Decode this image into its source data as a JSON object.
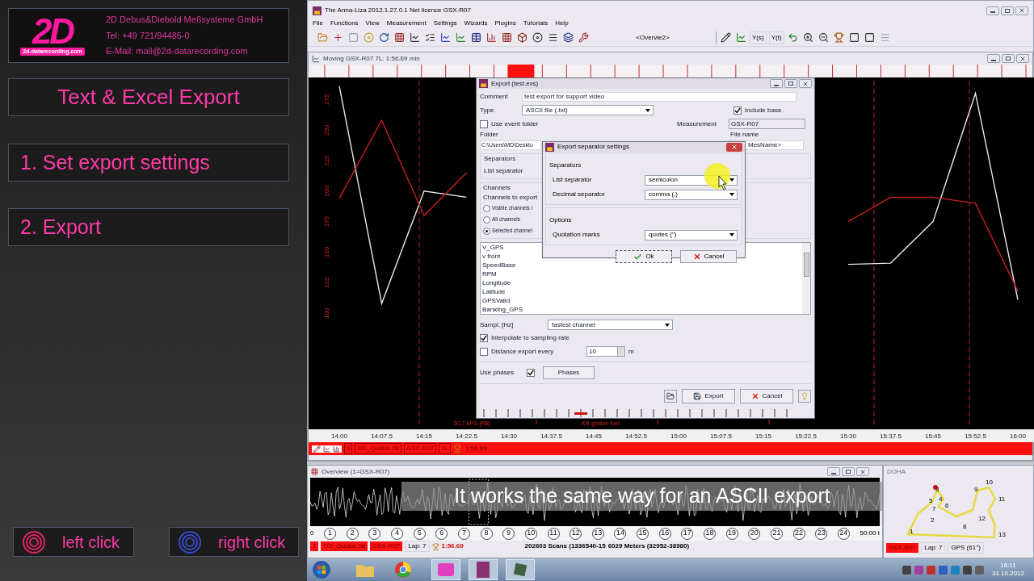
{
  "brand": {
    "logo": "2D",
    "logo_caption": "2d-datarecording.com",
    "company": "2D Debus&Diebold Meßsysteme GmbH",
    "phone": "Tel: +49 721/94485-0",
    "email": "E-Mail: mail@2d-datarecording.com"
  },
  "steps": [
    {
      "kind": "title",
      "label": "Text & Excel Export"
    },
    {
      "kind": "step",
      "label": "1. Set export settings"
    },
    {
      "kind": "step",
      "label": "2. Export"
    }
  ],
  "legend": [
    {
      "label": "left click",
      "color": "#e0245e"
    },
    {
      "label": "right click",
      "color": "#3848c8"
    }
  ],
  "app": {
    "title": "The Anna-Liza 2012.1.27.0.1   Net licence   GSX-R07",
    "menu": [
      "File",
      "Functions",
      "View",
      "Measurement",
      "Settings",
      "Wizards",
      "Plugins",
      "Tutorials",
      "Help"
    ],
    "view_name": "<Overvie2>",
    "axis_buttons": [
      "Y(s)",
      "Y(t)"
    ]
  },
  "moving": {
    "title": "Moving   GSX-R07 7L: 1:56.69 min",
    "markers": [
      "50.7 APS (RB)",
      "Kill ignition fuel"
    ],
    "chart_data": {
      "type": "line",
      "categories": [
        "14:00",
        "14:07.5",
        "14:15",
        "14:22.5",
        "14:30",
        "14:37.5",
        "14:45",
        "14:52.5",
        "15:00",
        "15:07.5",
        "15:15",
        "15:22.5",
        "15:30",
        "15:37.5",
        "15:45",
        "15:52.5",
        "16:00"
      ],
      "series": [
        {
          "color": "#e8e8e8",
          "values": [
            286,
            108,
            200,
            195,
            null,
            null,
            null,
            null,
            null,
            null,
            null,
            null,
            140,
            141,
            175,
            280,
            111
          ]
        },
        {
          "color": "#c82020",
          "values": [
            194,
            258,
            180,
            215,
            null,
            null,
            null,
            null,
            null,
            null,
            null,
            null,
            175,
            195,
            195,
            190,
            118
          ]
        }
      ],
      "ylim": [
        5,
        293
      ],
      "yticks": [
        100,
        125,
        150,
        175,
        200,
        225,
        250,
        275
      ]
    },
    "status": [
      "1",
      "DD_Quatar 08",
      "GSX-R07",
      "7L"
    ],
    "lap_time": "1:56.69"
  },
  "export_dialog": {
    "title": "Export (test.exs)",
    "comment_label": "Comment",
    "comment": "test export for support video",
    "type_label": "Type",
    "type": "ASCII file (.txt)",
    "include_base": {
      "label": "Include base",
      "checked": true
    },
    "use_event_folder": {
      "label": "Use event folder",
      "checked": false
    },
    "measurement_label": "Measurement",
    "measurement": "GSX-R07",
    "folder_label": "Folder",
    "folder": "C:\\Users\\MD\\Deskto",
    "file_name_label": "File name",
    "file_name": "MesName>",
    "separators_label": "Separators",
    "list_separator_label": "List separator",
    "channels_label": "Channels",
    "channels_to_export_label": "Channels to export",
    "channel_modes": [
      {
        "label": "Visible channels i",
        "selected": false
      },
      {
        "label": "All channels",
        "selected": false
      },
      {
        "label": "Selected channel",
        "selected": true
      }
    ],
    "channels": [
      "V_GPS",
      "v front",
      "SpeedBase",
      "RPM",
      "Longitude",
      "Latitude",
      "GPSValid",
      "Banking_GPS"
    ],
    "sampling_label": "Sampl. [Hz]",
    "sampling": "fastest channel",
    "interpolate": {
      "label": "Interpolate to sampling rate",
      "checked": true
    },
    "distance_export": {
      "label": "Distance export every",
      "checked": false
    },
    "distance": "10",
    "distance_unit": "m",
    "use_phases": {
      "label": "Use phases",
      "checked": true
    },
    "phases_button": "Phases",
    "export_button": "Export",
    "cancel_button": "Cancel"
  },
  "separator_dialog": {
    "title": "Export separator settings",
    "separators_label": "Separators",
    "rows": [
      {
        "label": "List separator",
        "value": "semicolon"
      },
      {
        "label": "Decimal separator",
        "value": "comma (,)"
      }
    ],
    "options_label": "Options",
    "options": [
      {
        "label": "Quotation marks",
        "value": "quotes (\")"
      }
    ],
    "ok_button": "Ok",
    "cancel_button": "Cancel"
  },
  "overview": {
    "title": "Overview (1=GSX-R07)",
    "start": "0",
    "end": "50:00 t",
    "laps": [
      "1",
      "2",
      "3",
      "4",
      "5",
      "6",
      "7",
      "8",
      "9",
      "10",
      "11",
      "12",
      "13",
      "14",
      "15",
      "16",
      "17",
      "18",
      "19",
      "20",
      "21",
      "22",
      "23",
      "24"
    ],
    "status": [
      "1",
      "DD_Quatar 08",
      "GSX-R07"
    ],
    "lap": "Lap: 7",
    "lap_time": "1:56.69",
    "scans": "202603 Scans (1336540-15",
    "meters": "6029 Meters (32952-38980)"
  },
  "track": {
    "title": "DOHA",
    "turns": [
      "1",
      "2",
      "3",
      "4",
      "5",
      "6",
      "7",
      "8",
      "9",
      "10",
      "11",
      "12",
      "13"
    ],
    "car": "GSX-R07",
    "lap": "Lap: 7",
    "gps": "GPS (61°)"
  },
  "caption": "It works the same way for an ASCII export",
  "taskbar": {
    "time": "16:11",
    "date": "31.10.2012"
  }
}
